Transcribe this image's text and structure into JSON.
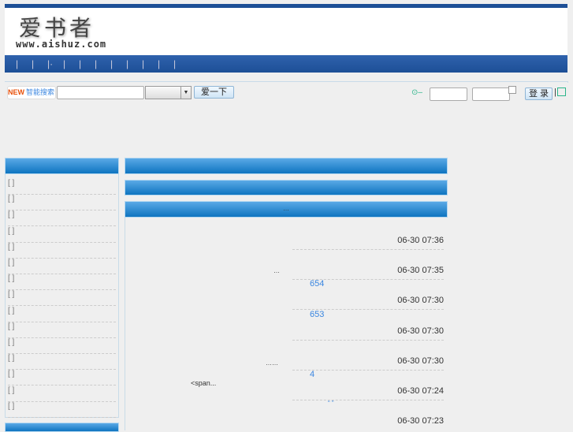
{
  "header": {
    "logo_text": "爱书者",
    "logo_url": "www.aishuz.com",
    "nav_separators": [
      "|",
      "|",
      "|·",
      "|",
      "|",
      "|",
      "|",
      "|",
      "|",
      "|",
      "|"
    ]
  },
  "search": {
    "badge": "NEW",
    "label": "智能搜索",
    "input_value": "",
    "select_value": "",
    "submit": "爱一下"
  },
  "login": {
    "username": "",
    "password": "",
    "remember": false,
    "submit": "登 录",
    "separator": "|"
  },
  "sidebar": {
    "items": [
      "[ ]",
      "[ ]",
      "[ ]",
      "[ ]",
      "[ ]",
      "[ ]",
      "[ ]",
      "[ ]",
      "[ ]",
      "[ ]",
      "[ ]",
      "[ ]",
      "[ ]",
      "[ ]",
      "[ ]"
    ]
  },
  "main": {
    "section3_title": "…",
    "rows": [
      {
        "time": "06-30 07:36",
        "link": "",
        "left": ""
      },
      {
        "time": "06-30 07:35",
        "link": "",
        "left": ""
      },
      {
        "time": "06-30 07:30",
        "link": "654",
        "left": "…"
      },
      {
        "time": "06-30 07:30",
        "link": "653",
        "left": ""
      },
      {
        "time": "06-30 07:30",
        "link": "",
        "left": ""
      },
      {
        "time": "06-30 07:24",
        "link": "4",
        "left": "……"
      },
      {
        "time": "06-30 07:23",
        "link": "“ ”",
        "left": ""
      }
    ],
    "span_text": "<span..."
  }
}
